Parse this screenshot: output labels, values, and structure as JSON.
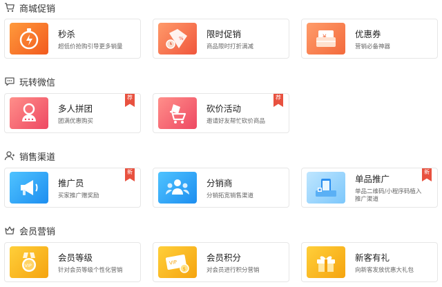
{
  "sections": [
    {
      "title": "商城促销",
      "icon": "cart-icon",
      "cards": [
        {
          "name": "秒杀",
          "desc": "超低价抢购引导更多销量",
          "icon": "stopwatch-icon"
        },
        {
          "name": "限时促销",
          "desc": "商品限时打折满减",
          "icon": "discount-tag-icon"
        },
        {
          "name": "优惠券",
          "desc": "营销必备神器",
          "icon": "coupon-icon"
        }
      ]
    },
    {
      "title": "玩转微信",
      "icon": "chat-icon",
      "cards": [
        {
          "name": "多人拼团",
          "desc": "团满优惠购买",
          "icon": "group-buy-icon",
          "badge": "荐"
        },
        {
          "name": "砍价活动",
          "desc": "邀请好友帮忙砍价商品",
          "icon": "bargain-cart-icon",
          "badge": "荐"
        }
      ]
    },
    {
      "title": "销售渠道",
      "icon": "user-icon",
      "cards": [
        {
          "name": "推广员",
          "desc": "买家推广赠奖励",
          "icon": "megaphone-icon",
          "badge": "新"
        },
        {
          "name": "分销商",
          "desc": "分销拓宽销售渠道",
          "icon": "distributor-icon"
        },
        {
          "name": "单品推广",
          "desc": "单品二维码/小程序码植入推广渠道",
          "icon": "product-promo-icon",
          "badge": "新"
        }
      ]
    },
    {
      "title": "会员营销",
      "icon": "crown-icon",
      "cards": [
        {
          "name": "会员等级",
          "desc": "针对会员等级个性化营销",
          "icon": "vip-medal-icon"
        },
        {
          "name": "会员积分",
          "desc": "对会员进行积分营销",
          "icon": "vip-card-icon"
        },
        {
          "name": "新客有礼",
          "desc": "向新客发放优惠大礼包",
          "icon": "gift-icon"
        }
      ]
    }
  ]
}
